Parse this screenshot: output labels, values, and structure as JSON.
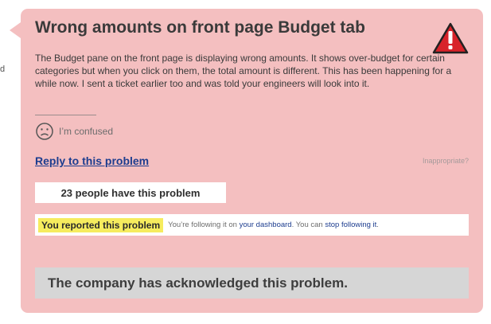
{
  "left_edge_text": "d",
  "problem": {
    "title": "Wrong amounts on front page Budget tab",
    "body": "The Budget pane on the front page is displaying wrong amounts. It shows over-budget for certain categories but when you click on them, the total amount is different. This has been happening for a while now. I sent a ticket earlier too and was told your engineers will look into it.",
    "mood_label": "I’m confused",
    "warning_icon": "warning-triangle-icon",
    "mood_icon": "sad-face-icon"
  },
  "actions": {
    "reply_link": "Reply to this problem",
    "inappropriate_link": "Inappropriate?"
  },
  "stats": {
    "people_count_text": "23 people have this problem"
  },
  "following": {
    "reported_badge": "You reported this problem",
    "text_before": "You’re following it on",
    "dashboard_link": "your dashboard",
    "text_middle": ". You can",
    "stop_link": "stop following it",
    "text_after": "."
  },
  "status": {
    "acknowledged_text": "The company has acknowledged this problem."
  },
  "colors": {
    "card_background": "#f4bfc0",
    "warning_red": "#d8232a",
    "link_blue": "#1d3d8f",
    "badge_yellow": "#f6ec5e",
    "status_gray": "#d6d6d6"
  }
}
